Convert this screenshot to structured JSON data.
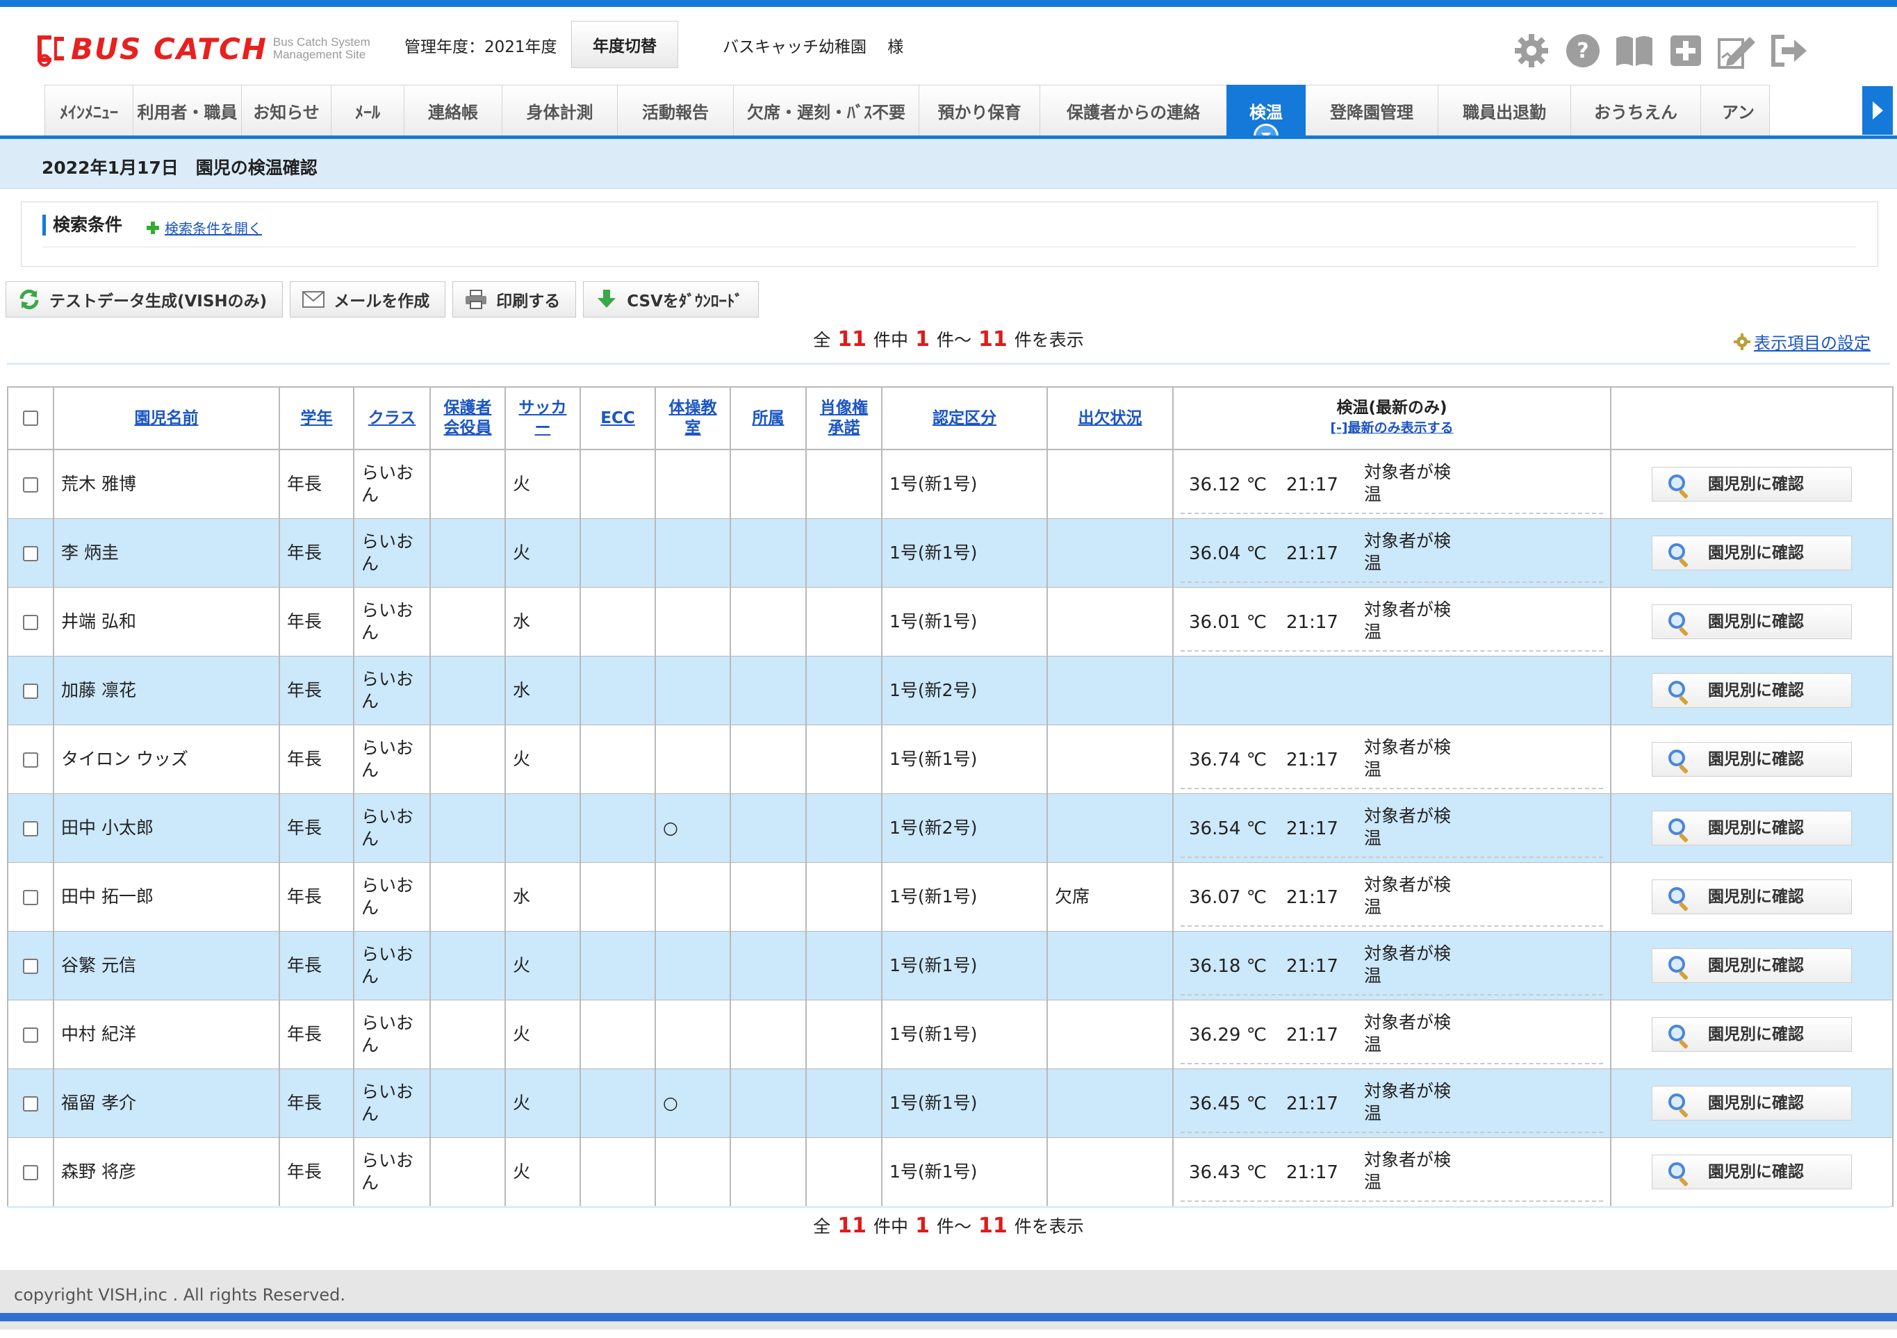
{
  "header": {
    "logo_text": "BUS CATCH",
    "logo_sub1": "Bus Catch System",
    "logo_sub2": "Management Site",
    "admin_year": "管理年度：2021年度",
    "year_switch_label": "年度切替",
    "org_name": "バスキャッチ幼稚園　 様",
    "icons": [
      "gear-icon",
      "help-icon",
      "book-icon",
      "plus-icon",
      "edit-icon",
      "logout-icon"
    ]
  },
  "nav": {
    "tabs": [
      {
        "label": "ﾒｲﾝﾒﾆｭｰ"
      },
      {
        "label": "利用者・職員"
      },
      {
        "label": "お知らせ"
      },
      {
        "label": "ﾒｰﾙ"
      },
      {
        "label": "連絡帳"
      },
      {
        "label": "身体計測"
      },
      {
        "label": "活動報告"
      },
      {
        "label": "欠席・遅刻・ﾊﾞｽ不要"
      },
      {
        "label": "預かり保育"
      },
      {
        "label": "保護者からの連絡"
      },
      {
        "label": "検温"
      },
      {
        "label": "登降園管理"
      },
      {
        "label": "職員出退勤"
      },
      {
        "label": "おうちえん"
      },
      {
        "label": "アン"
      }
    ],
    "active": "検温"
  },
  "page": {
    "title": "2022年1月17日　園児の検温確認"
  },
  "search": {
    "title": "検索条件",
    "toggle_label": "検索条件を開く"
  },
  "toolbar": {
    "test_data": "テストデータ生成(VISHのみ)",
    "mail": "メールを作成",
    "print": "印刷する",
    "csv": "CSVをﾀﾞｳﾝﾛｰﾄﾞ"
  },
  "pager": {
    "prefix": "全",
    "total": "11",
    "mid1": "件中",
    "from": "1",
    "mid2": "件～",
    "to": "11",
    "suffix": "件を表示"
  },
  "display_settings": "表示項目の設定",
  "table": {
    "headers": {
      "name": "園児名前",
      "grade": "学年",
      "class": "クラス",
      "parent_officer_1": "保護者",
      "parent_officer_2": "会役員",
      "soccer_1": "サッカ",
      "soccer_2": "ー",
      "ecc": "ECC",
      "gym_1": "体操教",
      "gym_2": "室",
      "affiliation": "所属",
      "portrait_1": "肖像権",
      "portrait_2": "承諾",
      "cert": "認定区分",
      "attendance": "出欠状況",
      "temp": "検温(最新のみ)",
      "temp_sub": "[-]最新のみ表示する"
    },
    "confirm_label": "園児別に確認",
    "rows": [
      {
        "name": "荒木 雅博",
        "grade": "年長",
        "class1": "らいお",
        "class2": "ん",
        "officer": "",
        "soccer": "火",
        "ecc": "",
        "gym": "",
        "aff": "",
        "portrait": "",
        "cert": "1号(新1号)",
        "attendance": "",
        "temp": "36.12 ℃",
        "time": "21:17",
        "who1": "対象者が検",
        "who2": "温"
      },
      {
        "name": "李 炳圭",
        "grade": "年長",
        "class1": "らいお",
        "class2": "ん",
        "officer": "",
        "soccer": "火",
        "ecc": "",
        "gym": "",
        "aff": "",
        "portrait": "",
        "cert": "1号(新1号)",
        "attendance": "",
        "temp": "36.04 ℃",
        "time": "21:17",
        "who1": "対象者が検",
        "who2": "温"
      },
      {
        "name": "井端 弘和",
        "grade": "年長",
        "class1": "らいお",
        "class2": "ん",
        "officer": "",
        "soccer": "水",
        "ecc": "",
        "gym": "",
        "aff": "",
        "portrait": "",
        "cert": "1号(新1号)",
        "attendance": "",
        "temp": "36.01 ℃",
        "time": "21:17",
        "who1": "対象者が検",
        "who2": "温"
      },
      {
        "name": "加藤 凛花",
        "grade": "年長",
        "class1": "らいお",
        "class2": "ん",
        "officer": "",
        "soccer": "水",
        "ecc": "",
        "gym": "",
        "aff": "",
        "portrait": "",
        "cert": "1号(新2号)",
        "attendance": "",
        "temp": "",
        "time": "",
        "who1": "",
        "who2": ""
      },
      {
        "name": "タイロン ウッズ",
        "grade": "年長",
        "class1": "らいお",
        "class2": "ん",
        "officer": "",
        "soccer": "火",
        "ecc": "",
        "gym": "",
        "aff": "",
        "portrait": "",
        "cert": "1号(新1号)",
        "attendance": "",
        "temp": "36.74 ℃",
        "time": "21:17",
        "who1": "対象者が検",
        "who2": "温"
      },
      {
        "name": "田中 小太郎",
        "grade": "年長",
        "class1": "らいお",
        "class2": "ん",
        "officer": "",
        "soccer": "",
        "ecc": "",
        "gym": "○",
        "aff": "",
        "portrait": "",
        "cert": "1号(新2号)",
        "attendance": "",
        "temp": "36.54 ℃",
        "time": "21:17",
        "who1": "対象者が検",
        "who2": "温"
      },
      {
        "name": "田中 拓一郎",
        "grade": "年長",
        "class1": "らいお",
        "class2": "ん",
        "officer": "",
        "soccer": "水",
        "ecc": "",
        "gym": "",
        "aff": "",
        "portrait": "",
        "cert": "1号(新1号)",
        "attendance": "欠席",
        "temp": "36.07 ℃",
        "time": "21:17",
        "who1": "対象者が検",
        "who2": "温"
      },
      {
        "name": "谷繁 元信",
        "grade": "年長",
        "class1": "らいお",
        "class2": "ん",
        "officer": "",
        "soccer": "火",
        "ecc": "",
        "gym": "",
        "aff": "",
        "portrait": "",
        "cert": "1号(新1号)",
        "attendance": "",
        "temp": "36.18 ℃",
        "time": "21:17",
        "who1": "対象者が検",
        "who2": "温"
      },
      {
        "name": "中村 紀洋",
        "grade": "年長",
        "class1": "らいお",
        "class2": "ん",
        "officer": "",
        "soccer": "火",
        "ecc": "",
        "gym": "",
        "aff": "",
        "portrait": "",
        "cert": "1号(新1号)",
        "attendance": "",
        "temp": "36.29 ℃",
        "time": "21:17",
        "who1": "対象者が検",
        "who2": "温"
      },
      {
        "name": "福留 孝介",
        "grade": "年長",
        "class1": "らいお",
        "class2": "ん",
        "officer": "",
        "soccer": "火",
        "ecc": "",
        "gym": "○",
        "aff": "",
        "portrait": "",
        "cert": "1号(新1号)",
        "attendance": "",
        "temp": "36.45 ℃",
        "time": "21:17",
        "who1": "対象者が検",
        "who2": "温"
      },
      {
        "name": "森野 将彦",
        "grade": "年長",
        "class1": "らいお",
        "class2": "ん",
        "officer": "",
        "soccer": "火",
        "ecc": "",
        "gym": "",
        "aff": "",
        "portrait": "",
        "cert": "1号(新1号)",
        "attendance": "",
        "temp": "36.43 ℃",
        "time": "21:17",
        "who1": "対象者が検",
        "who2": "温"
      }
    ]
  },
  "footer": {
    "copyright": "copyright VISH,inc . All rights Reserved."
  },
  "colors": {
    "accent": "#1479d8",
    "row_alt": "#cce8fb",
    "brand_red": "#e8201f",
    "count_red": "#e01a1a",
    "link": "#1a55c4"
  }
}
